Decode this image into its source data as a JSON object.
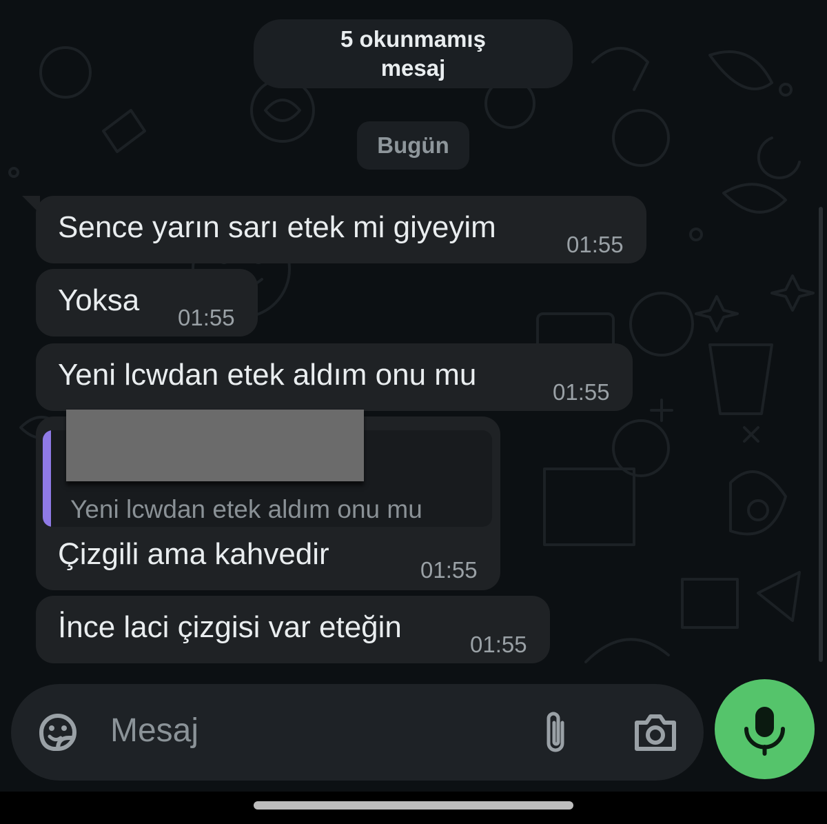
{
  "chat": {
    "unread_banner": {
      "line1": "5 okunmamış",
      "line2": "mesaj"
    },
    "date_divider": "Bugün",
    "messages": [
      {
        "text": "Sence yarın sarı etek mi giyeyim",
        "time": "01:55"
      },
      {
        "text": "Yoksa",
        "time": "01:55"
      },
      {
        "text": "Yeni lcwdan etek aldım onu mu",
        "time": "01:55"
      },
      {
        "text": "Çizgili ama kahvedir",
        "time": "01:55",
        "reply_to": {
          "text": "Yeni lcwdan etek aldım onu mu"
        }
      },
      {
        "text": "İnce laci çizgisi var eteğin",
        "time": "01:55"
      }
    ]
  },
  "composer": {
    "placeholder": "Mesaj",
    "emoji_icon": "sticker-face-icon",
    "attach_icon": "paperclip-icon",
    "camera_icon": "camera-icon",
    "mic_icon": "microphone-icon"
  },
  "colors": {
    "background": "#0c1013",
    "bubble": "#1f2225",
    "reply_accent": "#8f7ae6",
    "mic_button": "#55c46b"
  }
}
